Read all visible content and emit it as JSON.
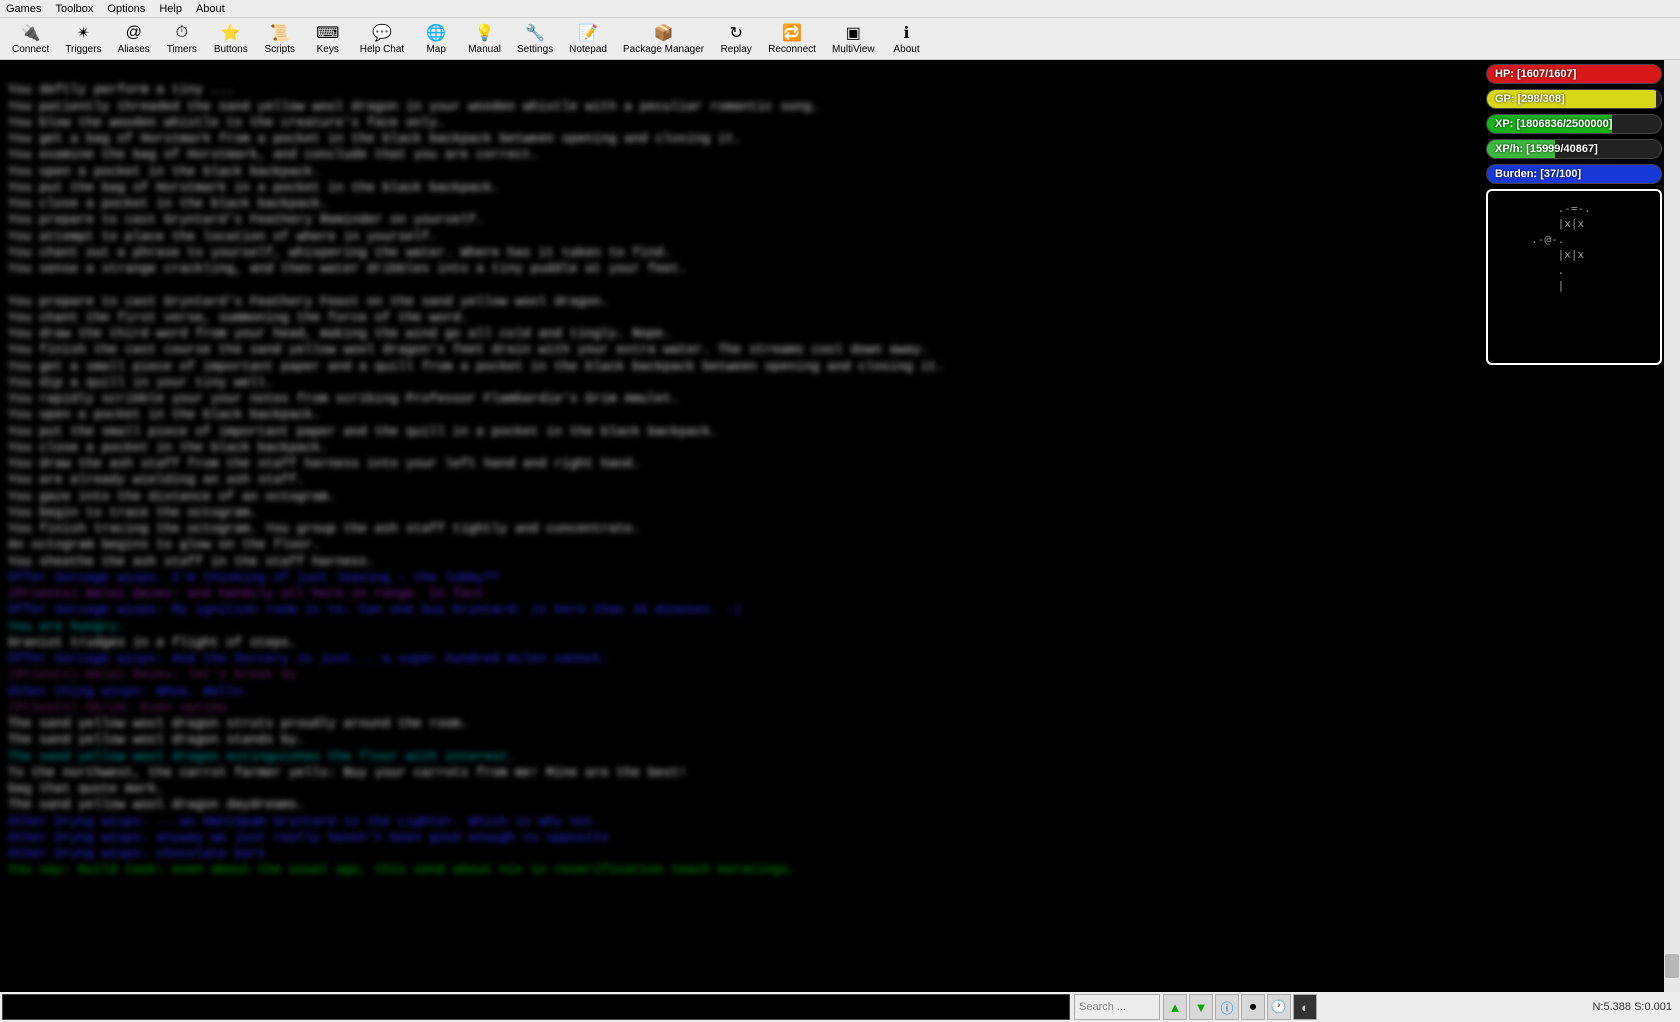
{
  "menu": {
    "games": "Games",
    "toolbox": "Toolbox",
    "options": "Options",
    "help": "Help",
    "about": "About"
  },
  "toolbar": [
    {
      "label": "Connect",
      "icon": "🔌"
    },
    {
      "label": "Triggers",
      "icon": "✴"
    },
    {
      "label": "Aliases",
      "icon": "@"
    },
    {
      "label": "Timers",
      "icon": "⏱"
    },
    {
      "label": "Buttons",
      "icon": "⭐"
    },
    {
      "label": "Scripts",
      "icon": "📜"
    },
    {
      "label": "Keys",
      "icon": "⌨"
    },
    {
      "label": "Help Chat",
      "icon": "💬"
    },
    {
      "label": "Map",
      "icon": "🌐"
    },
    {
      "label": "Manual",
      "icon": "💡"
    },
    {
      "label": "Settings",
      "icon": "🔧"
    },
    {
      "label": "Notepad",
      "icon": "📝"
    },
    {
      "label": "Package Manager",
      "icon": "📦"
    },
    {
      "label": "Replay",
      "icon": "↻"
    },
    {
      "label": "Reconnect",
      "icon": "🔁"
    },
    {
      "label": "MultiView",
      "icon": "▣"
    },
    {
      "label": "About",
      "icon": "ℹ"
    }
  ],
  "bars": {
    "hp": {
      "label": "HP: [1607/1607]",
      "color": "#d81818",
      "pct": 100
    },
    "gp": {
      "label": "GP: [298/308]",
      "color": "#d8d818",
      "pct": 97
    },
    "xp": {
      "label": "XP: [1806836/2500000]",
      "color": "#18b018",
      "pct": 72
    },
    "xph": {
      "label": "XP/h: [15999/40867]",
      "color": "#3cb83c",
      "pct": 39
    },
    "burden": {
      "label": "Burden: [37/100]",
      "color": "#1838d8",
      "pct": 100
    }
  },
  "minimap": "         .-=-.\n         |x|x\n     .-@-.\n         |x|x\n         .\n         |",
  "search_placeholder": "Search ...",
  "status": "N:5.388  S:0.001",
  "console_lines": [
    {
      "t": "",
      "c": ""
    },
    {
      "t": "You deftly perform a tiny ...",
      "c": ""
    },
    {
      "t": "You patiently threaded the sand yellow wool dragon in your wooden whistle with a peculiar romantic song.",
      "c": ""
    },
    {
      "t": "You blow the wooden whistle to the creature's face only.",
      "c": ""
    },
    {
      "t": "You get a bag of Horstmark from a pocket in the black backpack between opening and closing it.",
      "c": ""
    },
    {
      "t": "You examine the bag of Horstmark, and conclude that you are correct.",
      "c": ""
    },
    {
      "t": "You open a pocket in the black backpack.",
      "c": ""
    },
    {
      "t": "You put the bag of Horstmark in a pocket in the black backpack.",
      "c": ""
    },
    {
      "t": "You close a pocket in the black backpack.",
      "c": ""
    },
    {
      "t": "You prepare to cast Gryntard's Feathery Reminder on yourself.",
      "c": ""
    },
    {
      "t": "You attempt to place the location of where in yourself.",
      "c": ""
    },
    {
      "t": "You chant out a phrase to yourself, whispering the water. Where has it taken to find.",
      "c": ""
    },
    {
      "t": "You sense a strange crackling, and then water dribbles into a tiny puddle at your feet.",
      "c": ""
    },
    {
      "t": "",
      "c": ""
    },
    {
      "t": "You prepare to cast Gryntard's Feathery Feast on the sand yellow wool dragon.",
      "c": ""
    },
    {
      "t": "You chant the first verse, summoning the force of the word.",
      "c": ""
    },
    {
      "t": "You draw the third word from your head, making the wind go all cold and tingly. Nope.",
      "c": ""
    },
    {
      "t": "You finish the cast course the sand yellow wool dragon's feet drain with your extra water. The streams cool down away.",
      "c": ""
    },
    {
      "t": "You get a small piece of important paper and a quill from a pocket in the black backpack between opening and closing it.",
      "c": ""
    },
    {
      "t": "You dip a quill in your tiny well.",
      "c": ""
    },
    {
      "t": "You rapidly scribble your your notes from scribing Professor Flambardie's Grim Amulet.",
      "c": ""
    },
    {
      "t": "You open a pocket in the black backpack.",
      "c": ""
    },
    {
      "t": "You put the small piece of important paper and the quill in a pocket in the black backpack.",
      "c": ""
    },
    {
      "t": "You close a pocket in the black backpack.",
      "c": ""
    },
    {
      "t": "You draw the ash staff from the staff harness into your left hand and right hand.",
      "c": ""
    },
    {
      "t": "You are already wielding an ash staff.",
      "c": ""
    },
    {
      "t": "You gaze into the distance of an octogram.",
      "c": ""
    },
    {
      "t": "You begin to trace the octogram.",
      "c": ""
    },
    {
      "t": "You finish tracing the octogram. You group the ash staff tightly and concentrate.",
      "c": ""
    },
    {
      "t": "An octogram begins to glow on the floor.",
      "c": ""
    },
    {
      "t": "You sheathe the ash staff in the staff harness.",
      "c": ""
    },
    {
      "t": "Offer Sorcage wisps. I'm thinking of just leaving — the lobby??",
      "c": "blue"
    },
    {
      "t": "(Priests) Walai Dezes: and handily all here in range. In fact",
      "c": "purple2"
    },
    {
      "t": "Offer Sorcage wisps: My ignition room is to: Can one buy Gryntard: is here than 10 minutes. :)",
      "c": "blue"
    },
    {
      "t": "You are hungry.",
      "c": "teal"
    },
    {
      "t": "Graniot trudges in a flight of steps.",
      "c": ""
    },
    {
      "t": "Offer Sorcage wisps: And the Sorcery is just... a super hundred miles cannot.",
      "c": "blue"
    },
    {
      "t": "(Priests) Walai Dezes: let's break by",
      "c": "purple"
    },
    {
      "t": "Other thing wisps: Whoa. Hello.",
      "c": "blue"
    },
    {
      "t": "(Priests) Okryd: Even optima",
      "c": "purple"
    },
    {
      "t": "The sand yellow wool dragon struts proudly around the room.",
      "c": ""
    },
    {
      "t": "The sand yellow wool dragon stands by.",
      "c": ""
    },
    {
      "t": "The sand yellow wool dragon extinguishes the floor with interest.",
      "c": "teal"
    },
    {
      "t": "To the northwest, the carrot farmer yells: Buy your carrots from me! Mine are the best!",
      "c": ""
    },
    {
      "t": "Gag that quote mark.",
      "c": ""
    },
    {
      "t": "The sand yellow wool dragon daydreams.",
      "c": ""
    },
    {
      "t": "Other Dryng wisps: ...an OmniSpam Gryntard is the Lighter. Which is why not.",
      "c": "blue"
    },
    {
      "t": "Other Dryng wisps: anyway we just really haven't been good enough to opposite",
      "c": "blue"
    },
    {
      "t": "Other Dryng wisps: chocolate bars",
      "c": "blue"
    },
    {
      "t": "You say: Guild task: even about the usual ago, this send about nix in reverification teach keratings.",
      "c": "green"
    }
  ]
}
